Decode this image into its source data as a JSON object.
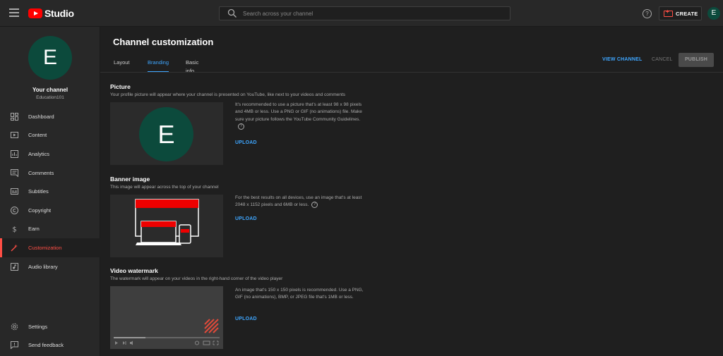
{
  "app": {
    "logo_text": "Studio",
    "avatar_letter": "E"
  },
  "search": {
    "placeholder": "Search across your channel"
  },
  "header": {
    "help_glyph": "?",
    "create_label": "CREATE"
  },
  "sidebar": {
    "avatar_letter": "E",
    "channel_name": "Your channel",
    "channel_handle": "Education101",
    "items": [
      {
        "label": "Dashboard",
        "icon": "dashboard-icon"
      },
      {
        "label": "Content",
        "icon": "content-icon"
      },
      {
        "label": "Analytics",
        "icon": "analytics-icon"
      },
      {
        "label": "Comments",
        "icon": "comments-icon"
      },
      {
        "label": "Subtitles",
        "icon": "subtitles-icon"
      },
      {
        "label": "Copyright",
        "icon": "copyright-icon"
      },
      {
        "label": "Earn",
        "icon": "earn-icon"
      },
      {
        "label": "Customization",
        "icon": "customization-icon",
        "active": true
      },
      {
        "label": "Audio library",
        "icon": "audio-library-icon"
      }
    ],
    "bottom_items": [
      {
        "label": "Settings",
        "icon": "settings-icon"
      },
      {
        "label": "Send feedback",
        "icon": "feedback-icon"
      }
    ]
  },
  "main": {
    "title": "Channel customization",
    "tabs": [
      {
        "label": "Layout"
      },
      {
        "label": "Branding",
        "active": true
      },
      {
        "label": "Basic info"
      }
    ],
    "actions": {
      "view_channel": "VIEW CHANNEL",
      "cancel": "CANCEL",
      "publish": "PUBLISH"
    },
    "picture": {
      "title": "Picture",
      "description": "Your profile picture will appear where your channel is presented on YouTube, like next to your videos and comments",
      "preview_letter": "E",
      "info": "It's recommended to use a picture that's at least 98 x 98 pixels and 4MB or less. Use a PNG or GIF (no animations) file. Make sure your picture follows the YouTube Community Guidelines.",
      "upload": "UPLOAD"
    },
    "banner": {
      "title": "Banner image",
      "description": "This image will appear across the top of your channel",
      "info": "For the best results on all devices, use an image that's at least 2048 x 1152 pixels and 6MB or less.",
      "upload": "UPLOAD"
    },
    "watermark": {
      "title": "Video watermark",
      "description": "The watermark will appear on your videos in the right-hand corner of the video player",
      "info": "An image that's 150 x 150 pixels is recommended. Use a PNG, GIF (no animations), BMP, or JPEG file that's 1MB or less.",
      "upload": "UPLOAD"
    }
  },
  "colors": {
    "accent_blue": "#3ea6ff",
    "active_red": "#ff4e45",
    "avatar_green": "#0c4a3c",
    "brand_red": "#ff0000"
  }
}
